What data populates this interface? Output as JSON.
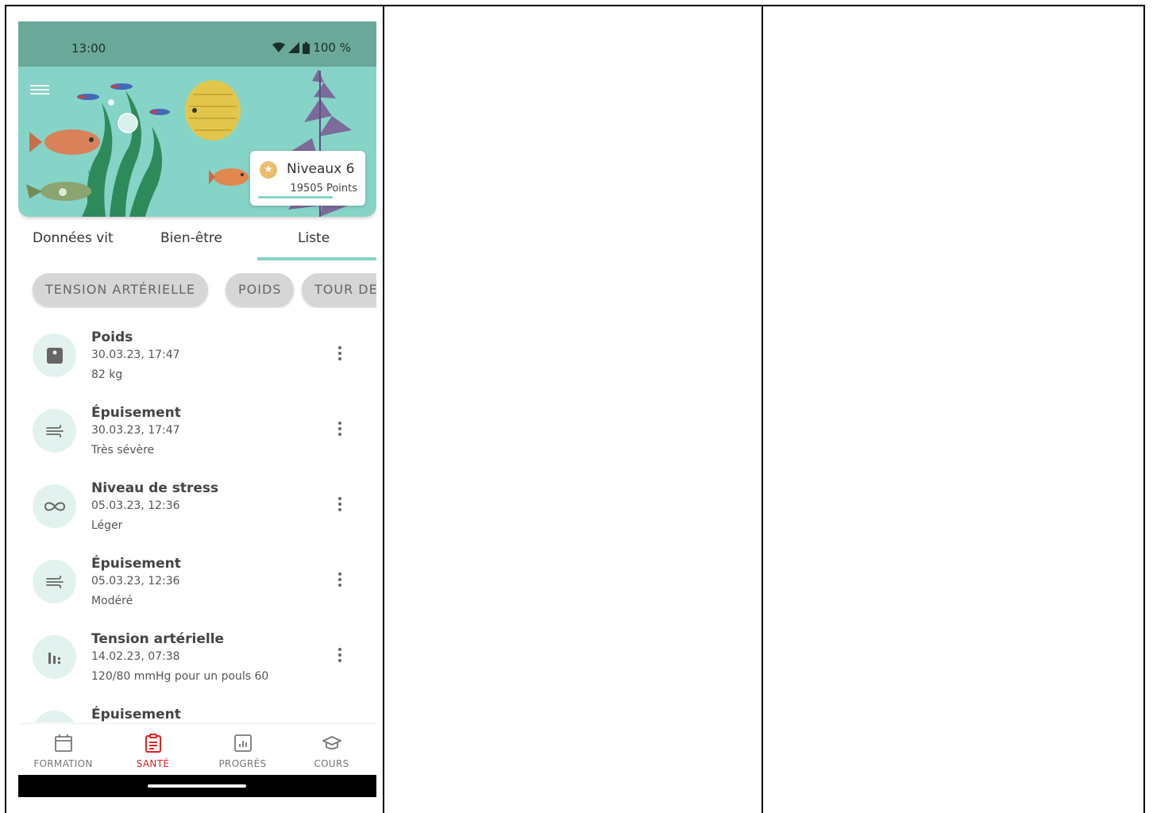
{
  "status_bar": {
    "time": "13:00",
    "battery": "100 %"
  },
  "hero": {
    "level_title": "Niveaux 6",
    "points": "19505 Points",
    "level_progress": 0.75
  },
  "tabs": [
    {
      "label": "Données vit",
      "active": false
    },
    {
      "label": "Bien-être",
      "active": false
    },
    {
      "label": "Liste",
      "active": true
    }
  ],
  "filters": [
    {
      "label": "TENSION ARTÉRIELLE"
    },
    {
      "label": "POIDS"
    },
    {
      "label": "TOUR DE"
    }
  ],
  "entries": [
    {
      "title": "Poids",
      "date": "30.03.23, 17:47",
      "value": "82 kg",
      "icon": "scale-icon"
    },
    {
      "title": "Épuisement",
      "date": "30.03.23, 17:47",
      "value": "Très sévère",
      "icon": "wind-icon"
    },
    {
      "title": "Niveau de stress",
      "date": "05.03.23, 12:36",
      "value": "Léger",
      "icon": "infinity-icon"
    },
    {
      "title": "Épuisement",
      "date": "05.03.23, 12:36",
      "value": "Modéré",
      "icon": "wind-icon"
    },
    {
      "title": "Tension artérielle",
      "date": "14.02.23, 07:38",
      "value": "120/80 mmHg pour un pouls 60",
      "icon": "bars-icon"
    },
    {
      "title": "Épuisement",
      "date": "",
      "value": "",
      "icon": "wind-icon"
    }
  ],
  "bottom_nav": [
    {
      "label": "FORMATION",
      "icon": "calendar-icon",
      "active": false
    },
    {
      "label": "SANTÉ",
      "icon": "clipboard-icon",
      "active": true
    },
    {
      "label": "PROGRÈS",
      "icon": "chart-icon",
      "active": false
    },
    {
      "label": "COURS",
      "icon": "graduation-cap-icon",
      "active": false
    }
  ],
  "colors": {
    "accent": "#86d3c8",
    "status_bar": "#6aa99a",
    "active_nav": "#dd2222"
  }
}
